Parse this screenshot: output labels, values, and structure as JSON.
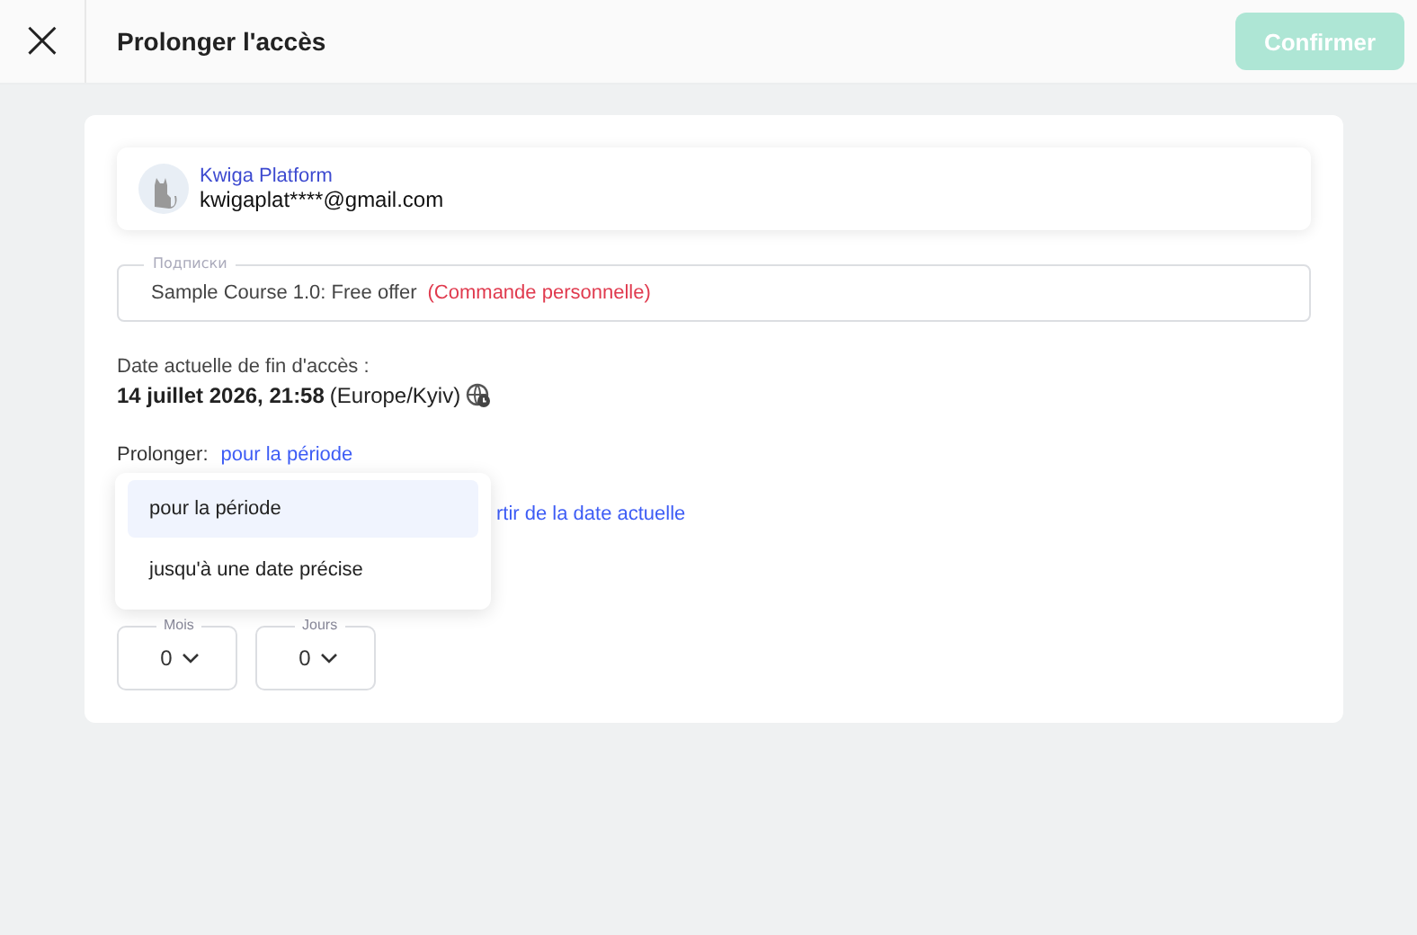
{
  "header": {
    "close": "×",
    "title": "Prolonger l'accès",
    "confirm": {
      "label": "Confirmer",
      "disabled": true
    }
  },
  "account": {
    "name": "Kwiga Platform",
    "email": "kwigaplat****@gmail.com"
  },
  "subscription": {
    "label": "Подписки",
    "value": "Sample Course 1.0: Free offer",
    "note": "(Commande personnelle)"
  },
  "current_end": {
    "label": "Date actuelle de fin d'accès :",
    "value": "14 juillet 2026, 21:58",
    "timezone": "(Europe/Kyiv)"
  },
  "extend": {
    "label": "Prolonger:",
    "mode": "pour la période",
    "start_option": "rtir de la date actuelle",
    "menu": [
      {
        "label": "pour la période",
        "selected": true
      },
      {
        "label": "jusqu'à une date précise",
        "selected": false
      }
    ],
    "fields": [
      {
        "label": "Mois",
        "value": "0"
      },
      {
        "label": "Jours",
        "value": "0"
      }
    ]
  }
}
